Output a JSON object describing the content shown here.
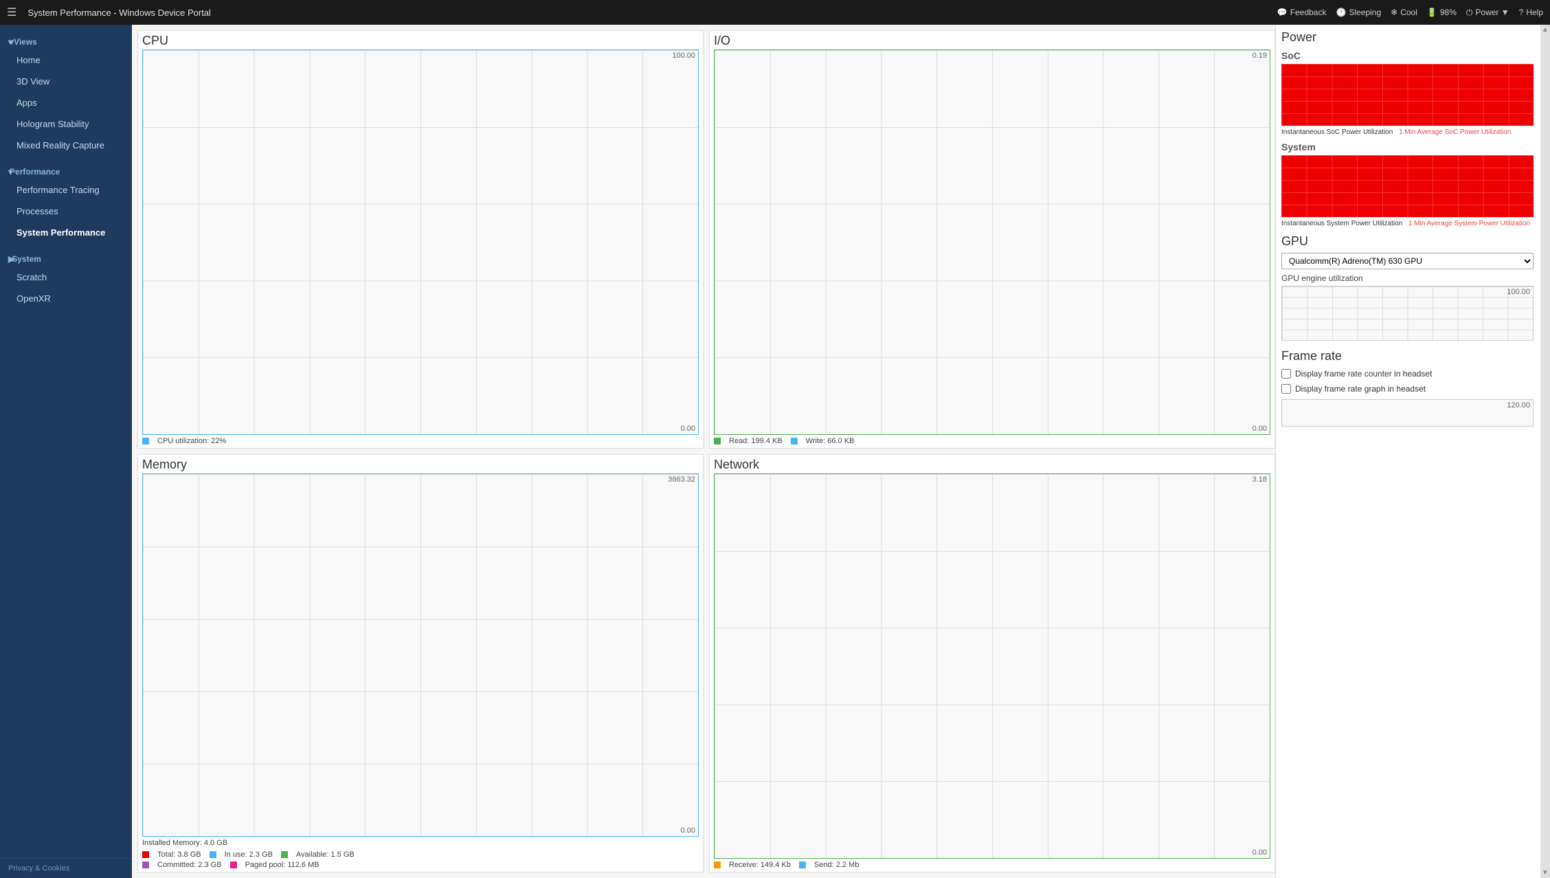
{
  "topbar": {
    "menu_icon": "☰",
    "title": "System Performance - Windows Device Portal",
    "actions": [
      {
        "label": "Feedback",
        "icon": "💬"
      },
      {
        "label": "Sleeping",
        "icon": "🕐"
      },
      {
        "label": "Cool",
        "icon": "❄"
      },
      {
        "label": "98%",
        "icon": "🔋"
      },
      {
        "label": "Power ▼",
        "icon": "⏻"
      },
      {
        "label": "Help",
        "icon": "?"
      }
    ]
  },
  "sidebar": {
    "collapse_icon": "◀",
    "views_label": "▾Views",
    "items_views": [
      {
        "label": "Home",
        "active": false
      },
      {
        "label": "3D View",
        "active": false
      },
      {
        "label": "Apps",
        "active": false
      },
      {
        "label": "Hologram Stability",
        "active": false
      },
      {
        "label": "Mixed Reality Capture",
        "active": false
      }
    ],
    "performance_label": "▾Performance",
    "items_performance": [
      {
        "label": "Performance Tracing",
        "active": false
      },
      {
        "label": "Processes",
        "active": false
      },
      {
        "label": "System Performance",
        "active": true
      }
    ],
    "system_label": "▶System",
    "items_system": [
      {
        "label": "Scratch",
        "active": false
      },
      {
        "label": "OpenXR",
        "active": false
      }
    ],
    "footer": "Privacy & Cookies"
  },
  "cpu": {
    "title": "CPU",
    "max_label": "100.00",
    "min_label": "0.00",
    "legend_text": "CPU utilization: 22%",
    "legend_color": "legend-blue"
  },
  "io": {
    "title": "I/O",
    "max_label": "0.19",
    "min_label": "0.00",
    "legend_read": "Read: 199.4 KB",
    "legend_write": "Write: 66.0 KB"
  },
  "memory": {
    "title": "Memory",
    "max_label": "3863.32",
    "min_label": "0.00",
    "installed": "Installed Memory: 4.0 GB",
    "legend_items": [
      {
        "color": "legend-red",
        "label": "Total: 3.8 GB"
      },
      {
        "color": "legend-blue",
        "label": "In use: 2.3 GB"
      },
      {
        "color": "legend-green",
        "label": "Available: 1.5 GB"
      },
      {
        "color": "legend-purple",
        "label": "Committed: 2.3 GB"
      },
      {
        "color": "legend-pink",
        "label": "Paged pool: 112.6 MB"
      }
    ]
  },
  "network": {
    "title": "Network",
    "max_label": "3.18",
    "min_label": "0.00",
    "legend_receive": "Receive: 149.4 Kb",
    "legend_send": "Send: 2.2 Mb"
  },
  "power": {
    "title": "Power",
    "soc_label": "SoC",
    "soc_legend_inst": "Instantaneous SoC Power Utilization",
    "soc_legend_avg": "1 Min Average SoC Power Utilization",
    "system_label": "System",
    "system_legend_inst": "Instantaneous System Power Utilization",
    "system_legend_avg": "1 Min Average System Power Utilization"
  },
  "gpu": {
    "title": "GPU",
    "select_options": [
      "Qualcomm(R) Adreno(TM) 630 GPU"
    ],
    "selected_option": "Qualcomm(R) Adreno(TM) 630 GPU",
    "engine_label": "GPU engine utilization",
    "max_label": "100.00"
  },
  "framerate": {
    "title": "Frame rate",
    "checkbox1": "Display frame rate counter in headset",
    "checkbox2": "Display frame rate graph in headset",
    "max_label": "120.00"
  }
}
